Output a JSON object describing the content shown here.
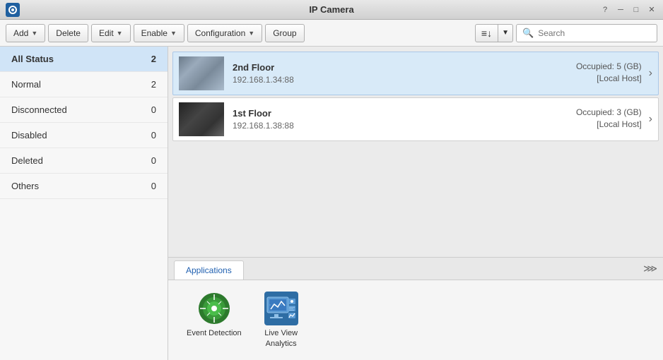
{
  "titleBar": {
    "title": "IP Camera",
    "controls": {
      "help": "?",
      "minimize": "─",
      "maximize": "□",
      "close": "✕"
    }
  },
  "toolbar": {
    "add_label": "Add",
    "delete_label": "Delete",
    "edit_label": "Edit",
    "enable_label": "Enable",
    "configuration_label": "Configuration",
    "group_label": "Group",
    "search_placeholder": "Search"
  },
  "sidebar": {
    "items": [
      {
        "id": "all-status",
        "label": "All Status",
        "count": "2",
        "active": true
      },
      {
        "id": "normal",
        "label": "Normal",
        "count": "2",
        "active": false
      },
      {
        "id": "disconnected",
        "label": "Disconnected",
        "count": "0",
        "active": false
      },
      {
        "id": "disabled",
        "label": "Disabled",
        "count": "0",
        "active": false
      },
      {
        "id": "deleted",
        "label": "Deleted",
        "count": "0",
        "active": false
      },
      {
        "id": "others",
        "label": "Others",
        "count": "0",
        "active": false
      }
    ]
  },
  "cameras": [
    {
      "id": "cam1",
      "name": "2nd Floor",
      "ip": "192.168.1.34:88",
      "occupied": "Occupied: 5 (GB)",
      "host": "[Local Host]",
      "selected": true,
      "thumbStyle": "2nd"
    },
    {
      "id": "cam2",
      "name": "1st Floor",
      "ip": "192.168.1.38:88",
      "occupied": "Occupied: 3 (GB)",
      "host": "[Local Host]",
      "selected": false,
      "thumbStyle": "1st"
    }
  ],
  "applications": {
    "tab_label": "Applications",
    "apps": [
      {
        "id": "event-detection",
        "label": "Event Detection"
      },
      {
        "id": "live-view-analytics",
        "label": "Live View\nAnalytics"
      }
    ]
  }
}
